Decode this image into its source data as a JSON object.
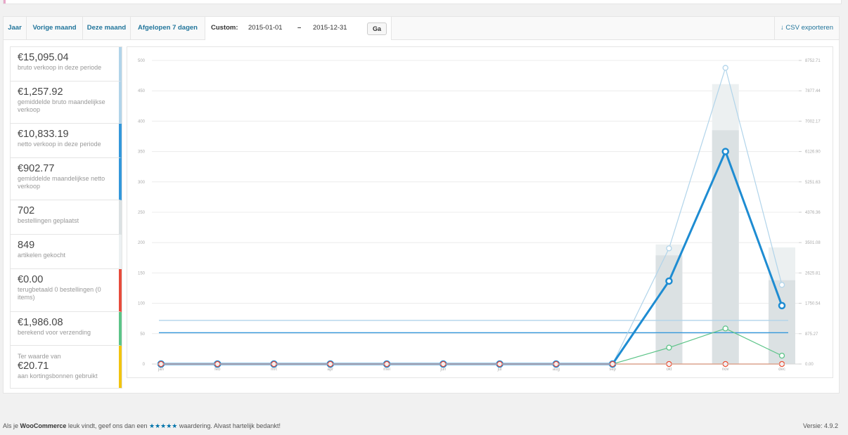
{
  "range_tabs": [
    {
      "label": "Jaar"
    },
    {
      "label": "Vorige maand"
    },
    {
      "label": "Deze maand"
    },
    {
      "label": "Afgelopen 7 dagen"
    }
  ],
  "custom": {
    "label": "Custom:",
    "start": "2015-01-01",
    "dash": "–",
    "end": "2015-12-31",
    "button": "Ga"
  },
  "export": {
    "icon": "download-arrow-icon",
    "label": "CSV exporteren"
  },
  "legend": [
    {
      "value": "€15,095.04",
      "desc": "bruto verkoop in deze periode",
      "color": "#b1d4ea"
    },
    {
      "value": "€1,257.92",
      "desc": "gemiddelde bruto maandelijkse verkoop",
      "color": "#b1d4ea"
    },
    {
      "value": "€10,833.19",
      "desc": "netto verkoop in deze periode",
      "color": "#3498db"
    },
    {
      "value": "€902.77",
      "desc": "gemiddelde maandelijkse netto verkoop",
      "color": "#3498db"
    },
    {
      "value": "702",
      "desc": "bestellingen geplaatst",
      "color": "#dbe1e3"
    },
    {
      "value": "849",
      "desc": "artikelen gekocht",
      "color": "#ecf0f1"
    },
    {
      "value": "€0.00",
      "desc": "terugbetaald 0 bestellingen (0 items)",
      "color": "#e74c3c"
    },
    {
      "value": "€1,986.08",
      "desc": "berekend voor verzending",
      "color": "#5cc488"
    },
    {
      "prefix": "Ter waarde van",
      "value": "€20.71",
      "desc": "aan kortingsbonnen gebruikt",
      "color": "#f1c40f"
    }
  ],
  "chart_data": {
    "type": "line",
    "categories": [
      "jan",
      "feb",
      "mrt",
      "apr",
      "mei",
      "jun",
      "jul",
      "aug",
      "sep",
      "okt",
      "nov",
      "dec"
    ],
    "y_left": {
      "min": 0,
      "max": 500,
      "ticks": [
        "0",
        "50",
        "100",
        "150",
        "200",
        "250",
        "300",
        "350",
        "400",
        "450",
        "500"
      ]
    },
    "y_right": {
      "min": 0,
      "max": 8752.71,
      "ticks": [
        "0.00",
        "875.27",
        "1750.54",
        "2625.81",
        "3501.08",
        "4376.36",
        "5251.63",
        "6126.90",
        "7002.17",
        "7877.44",
        "8752.71"
      ]
    },
    "bars": [
      {
        "name": "artikelen gekocht",
        "axis": "left",
        "color": "#ecf0f1",
        "values": [
          0,
          0,
          0,
          0,
          0,
          0,
          0,
          0,
          0,
          197,
          461,
          192
        ]
      },
      {
        "name": "bestellingen geplaatst",
        "axis": "left",
        "color": "#dbe1e3",
        "values": [
          0,
          0,
          0,
          0,
          0,
          0,
          0,
          0,
          0,
          179,
          385,
          138
        ]
      }
    ],
    "series": [
      {
        "name": "bruto verkoop",
        "axis": "right",
        "color": "#b1d4ea",
        "width": 1.2,
        "values": [
          0,
          0,
          0,
          0,
          0,
          0,
          0,
          0,
          0,
          3335,
          8539,
          2282
        ]
      },
      {
        "name": "netto verkoop",
        "axis": "right",
        "color": "#1e8cd2",
        "width": 3,
        "values": [
          0,
          0,
          0,
          0,
          0,
          0,
          0,
          0,
          0,
          2392,
          6127,
          1684
        ]
      },
      {
        "name": "verzending",
        "axis": "right",
        "color": "#5cc488",
        "width": 1.2,
        "values": [
          0,
          0,
          0,
          0,
          0,
          0,
          0,
          0,
          0,
          473,
          1025,
          241
        ]
      },
      {
        "name": "terugbetaald",
        "axis": "right",
        "color": "#e74c3c",
        "width": 1.5,
        "values": [
          0,
          0,
          0,
          0,
          0,
          0,
          0,
          0,
          0,
          0,
          0,
          0
        ]
      },
      {
        "name": "kortingsbonnen",
        "axis": "right",
        "color": "#f1c40f",
        "width": 1.2,
        "values": [
          0,
          0,
          0,
          0,
          0,
          0,
          0,
          0,
          0,
          0,
          0,
          0
        ]
      }
    ],
    "averages": [
      {
        "name": "gemiddelde bruto maandelijkse verkoop",
        "axis": "right",
        "color": "#b1d4ea",
        "value": 1257.92
      },
      {
        "name": "gemiddelde maandelijkse netto verkoop",
        "axis": "right",
        "color": "#3498db",
        "value": 902.77
      }
    ]
  },
  "footer": {
    "text_before": "Als je",
    "brand": "WooCommerce",
    "text_mid": "leuk vindt, geef ons dan een",
    "stars": "★★★★★",
    "text_after": "waardering. Alvast hartelijk bedankt!",
    "version": "Versie: 4.9.2"
  }
}
